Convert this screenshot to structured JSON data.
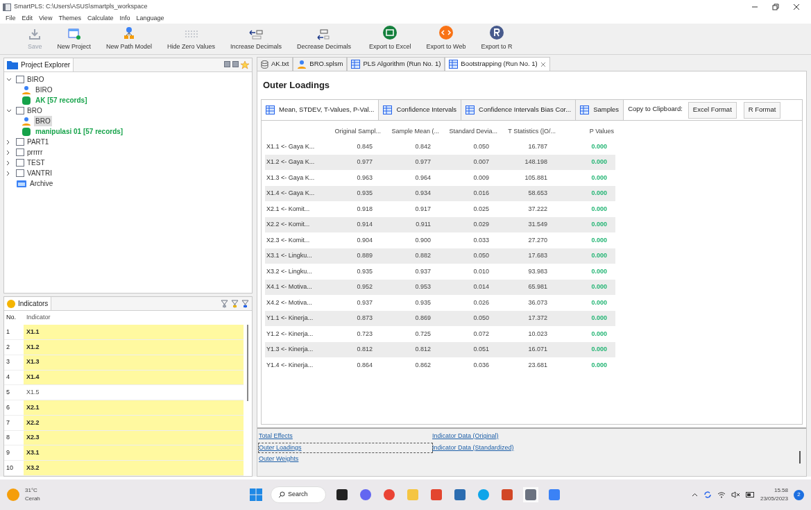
{
  "window": {
    "title": "SmartPLS: C:\\Users\\ASUS\\smartpls_workspace"
  },
  "menu": [
    "File",
    "Edit",
    "View",
    "Themes",
    "Calculate",
    "Info",
    "Language"
  ],
  "toolbar": [
    {
      "label": "Save",
      "kind": "save",
      "disabled": true
    },
    {
      "label": "New Project",
      "kind": "project",
      "disabled": false
    },
    {
      "label": "New Path Model",
      "kind": "model",
      "disabled": false
    },
    {
      "label": "Hide Zero Values",
      "kind": "zero",
      "disabled": false
    },
    {
      "label": "Increase Decimals",
      "kind": "inc",
      "disabled": false
    },
    {
      "label": "Decrease Decimals",
      "kind": "dec",
      "disabled": false
    },
    {
      "label": "Export to Excel",
      "kind": "excel",
      "disabled": false
    },
    {
      "label": "Export to Web",
      "kind": "web",
      "disabled": false
    },
    {
      "label": "Export to R",
      "kind": "r",
      "disabled": false
    }
  ],
  "project_explorer": {
    "title": "Project Explorer",
    "tree": [
      {
        "label": "BIRO",
        "kind": "project",
        "expanded": true,
        "children": [
          {
            "label": "BIRO",
            "kind": "model",
            "selected": false
          },
          {
            "label": "AK [57 records]",
            "kind": "data",
            "selected": false
          }
        ]
      },
      {
        "label": "BRO",
        "kind": "project",
        "expanded": true,
        "children": [
          {
            "label": "BRO",
            "kind": "model",
            "selected": true
          },
          {
            "label": "manipulasi 01 [57 records]",
            "kind": "data",
            "selected": false
          }
        ]
      },
      {
        "label": "PART1",
        "kind": "project",
        "expanded": false
      },
      {
        "label": "prrrrr",
        "kind": "project",
        "expanded": false
      },
      {
        "label": "TEST",
        "kind": "project",
        "expanded": false
      },
      {
        "label": "VANTRI",
        "kind": "project",
        "expanded": false
      },
      {
        "label": "Archive",
        "kind": "archive"
      }
    ]
  },
  "indicators": {
    "title": "Indicators",
    "columns": [
      "No.",
      "Indicator"
    ],
    "rows": [
      {
        "no": "1",
        "indicator": "X1.1",
        "highlighted": true
      },
      {
        "no": "2",
        "indicator": "X1.2",
        "highlighted": true
      },
      {
        "no": "3",
        "indicator": "X1.3",
        "highlighted": true
      },
      {
        "no": "4",
        "indicator": "X1.4",
        "highlighted": true
      },
      {
        "no": "5",
        "indicator": "X1.5",
        "highlighted": false
      },
      {
        "no": "6",
        "indicator": "X2.1",
        "highlighted": true
      },
      {
        "no": "7",
        "indicator": "X2.2",
        "highlighted": true
      },
      {
        "no": "8",
        "indicator": "X2.3",
        "highlighted": true
      },
      {
        "no": "9",
        "indicator": "X3.1",
        "highlighted": true
      },
      {
        "no": "10",
        "indicator": "X3.2",
        "highlighted": true
      }
    ]
  },
  "editor_tabs": [
    {
      "label": "AK.txt",
      "kind": "data",
      "selected": false
    },
    {
      "label": "BRO.splsm",
      "kind": "model",
      "selected": false
    },
    {
      "label": "PLS Algorithm (Run No. 1)",
      "kind": "table",
      "selected": false
    },
    {
      "label": "Bootstrapping (Run No. 1)",
      "kind": "table",
      "selected": true
    }
  ],
  "results": {
    "heading": "Outer Loadings",
    "subtabs": [
      {
        "label": "Mean, STDEV, T-Values, P-Val...",
        "selected": true
      },
      {
        "label": "Confidence Intervals",
        "selected": false
      },
      {
        "label": "Confidence Intervals Bias Cor...",
        "selected": false
      },
      {
        "label": "Samples",
        "selected": false
      }
    ],
    "clipboard_label": "Copy to Clipboard:",
    "clipboard_buttons": [
      "Excel Format",
      "R Format"
    ],
    "columns": [
      "",
      "Original Sampl...",
      "Sample Mean (...",
      "Standard Devia...",
      "T Statistics (|O/...",
      "P Values"
    ],
    "rows": [
      [
        "X1.1 <- Gaya K...",
        "0.845",
        "0.842",
        "0.050",
        "16.787",
        "0.000"
      ],
      [
        "X1.2 <- Gaya K...",
        "0.977",
        "0.977",
        "0.007",
        "148.198",
        "0.000"
      ],
      [
        "X1.3 <- Gaya K...",
        "0.963",
        "0.964",
        "0.009",
        "105.881",
        "0.000"
      ],
      [
        "X1.4 <- Gaya K...",
        "0.935",
        "0.934",
        "0.016",
        "58.653",
        "0.000"
      ],
      [
        "X2.1 <- Komit...",
        "0.918",
        "0.917",
        "0.025",
        "37.222",
        "0.000"
      ],
      [
        "X2.2 <- Komit...",
        "0.914",
        "0.911",
        "0.029",
        "31.549",
        "0.000"
      ],
      [
        "X2.3 <- Komit...",
        "0.904",
        "0.900",
        "0.033",
        "27.270",
        "0.000"
      ],
      [
        "X3.1 <- Lingku...",
        "0.889",
        "0.882",
        "0.050",
        "17.683",
        "0.000"
      ],
      [
        "X3.2 <- Lingku...",
        "0.935",
        "0.937",
        "0.010",
        "93.983",
        "0.000"
      ],
      [
        "X4.1 <- Motiva...",
        "0.952",
        "0.953",
        "0.014",
        "65.981",
        "0.000"
      ],
      [
        "X4.2 <- Motiva...",
        "0.937",
        "0.935",
        "0.026",
        "36.073",
        "0.000"
      ],
      [
        "Y1.1 <- Kinerja...",
        "0.873",
        "0.869",
        "0.050",
        "17.372",
        "0.000"
      ],
      [
        "Y1.2 <- Kinerja...",
        "0.723",
        "0.725",
        "0.072",
        "10.023",
        "0.000"
      ],
      [
        "Y1.3 <- Kinerja...",
        "0.812",
        "0.812",
        "0.051",
        "16.071",
        "0.000"
      ],
      [
        "Y1.4 <- Kinerja...",
        "0.864",
        "0.862",
        "0.036",
        "23.681",
        "0.000"
      ]
    ],
    "links": [
      [
        {
          "label": "Total Effects",
          "selected": false
        },
        {
          "label": "Outer Loadings",
          "selected": true
        },
        {
          "label": "Outer Weights",
          "selected": false
        }
      ],
      [
        {
          "label": "Indicator Data (Original)",
          "selected": false
        },
        {
          "label": "Indicator Data (Standardized)",
          "selected": false
        }
      ]
    ]
  },
  "taskbar": {
    "temperature": "31°C",
    "weather": "Cerah",
    "search": "Search",
    "apps": [
      {
        "kind": "store"
      },
      {
        "kind": "meet"
      },
      {
        "kind": "chrome"
      },
      {
        "kind": "folder"
      },
      {
        "kind": "office"
      },
      {
        "kind": "mail"
      },
      {
        "kind": "edge"
      },
      {
        "kind": "powerpoint"
      },
      {
        "kind": "smartpls"
      },
      {
        "kind": "photos"
      }
    ],
    "time": "15.58",
    "date": "23/05/2023",
    "notifications": "2"
  }
}
